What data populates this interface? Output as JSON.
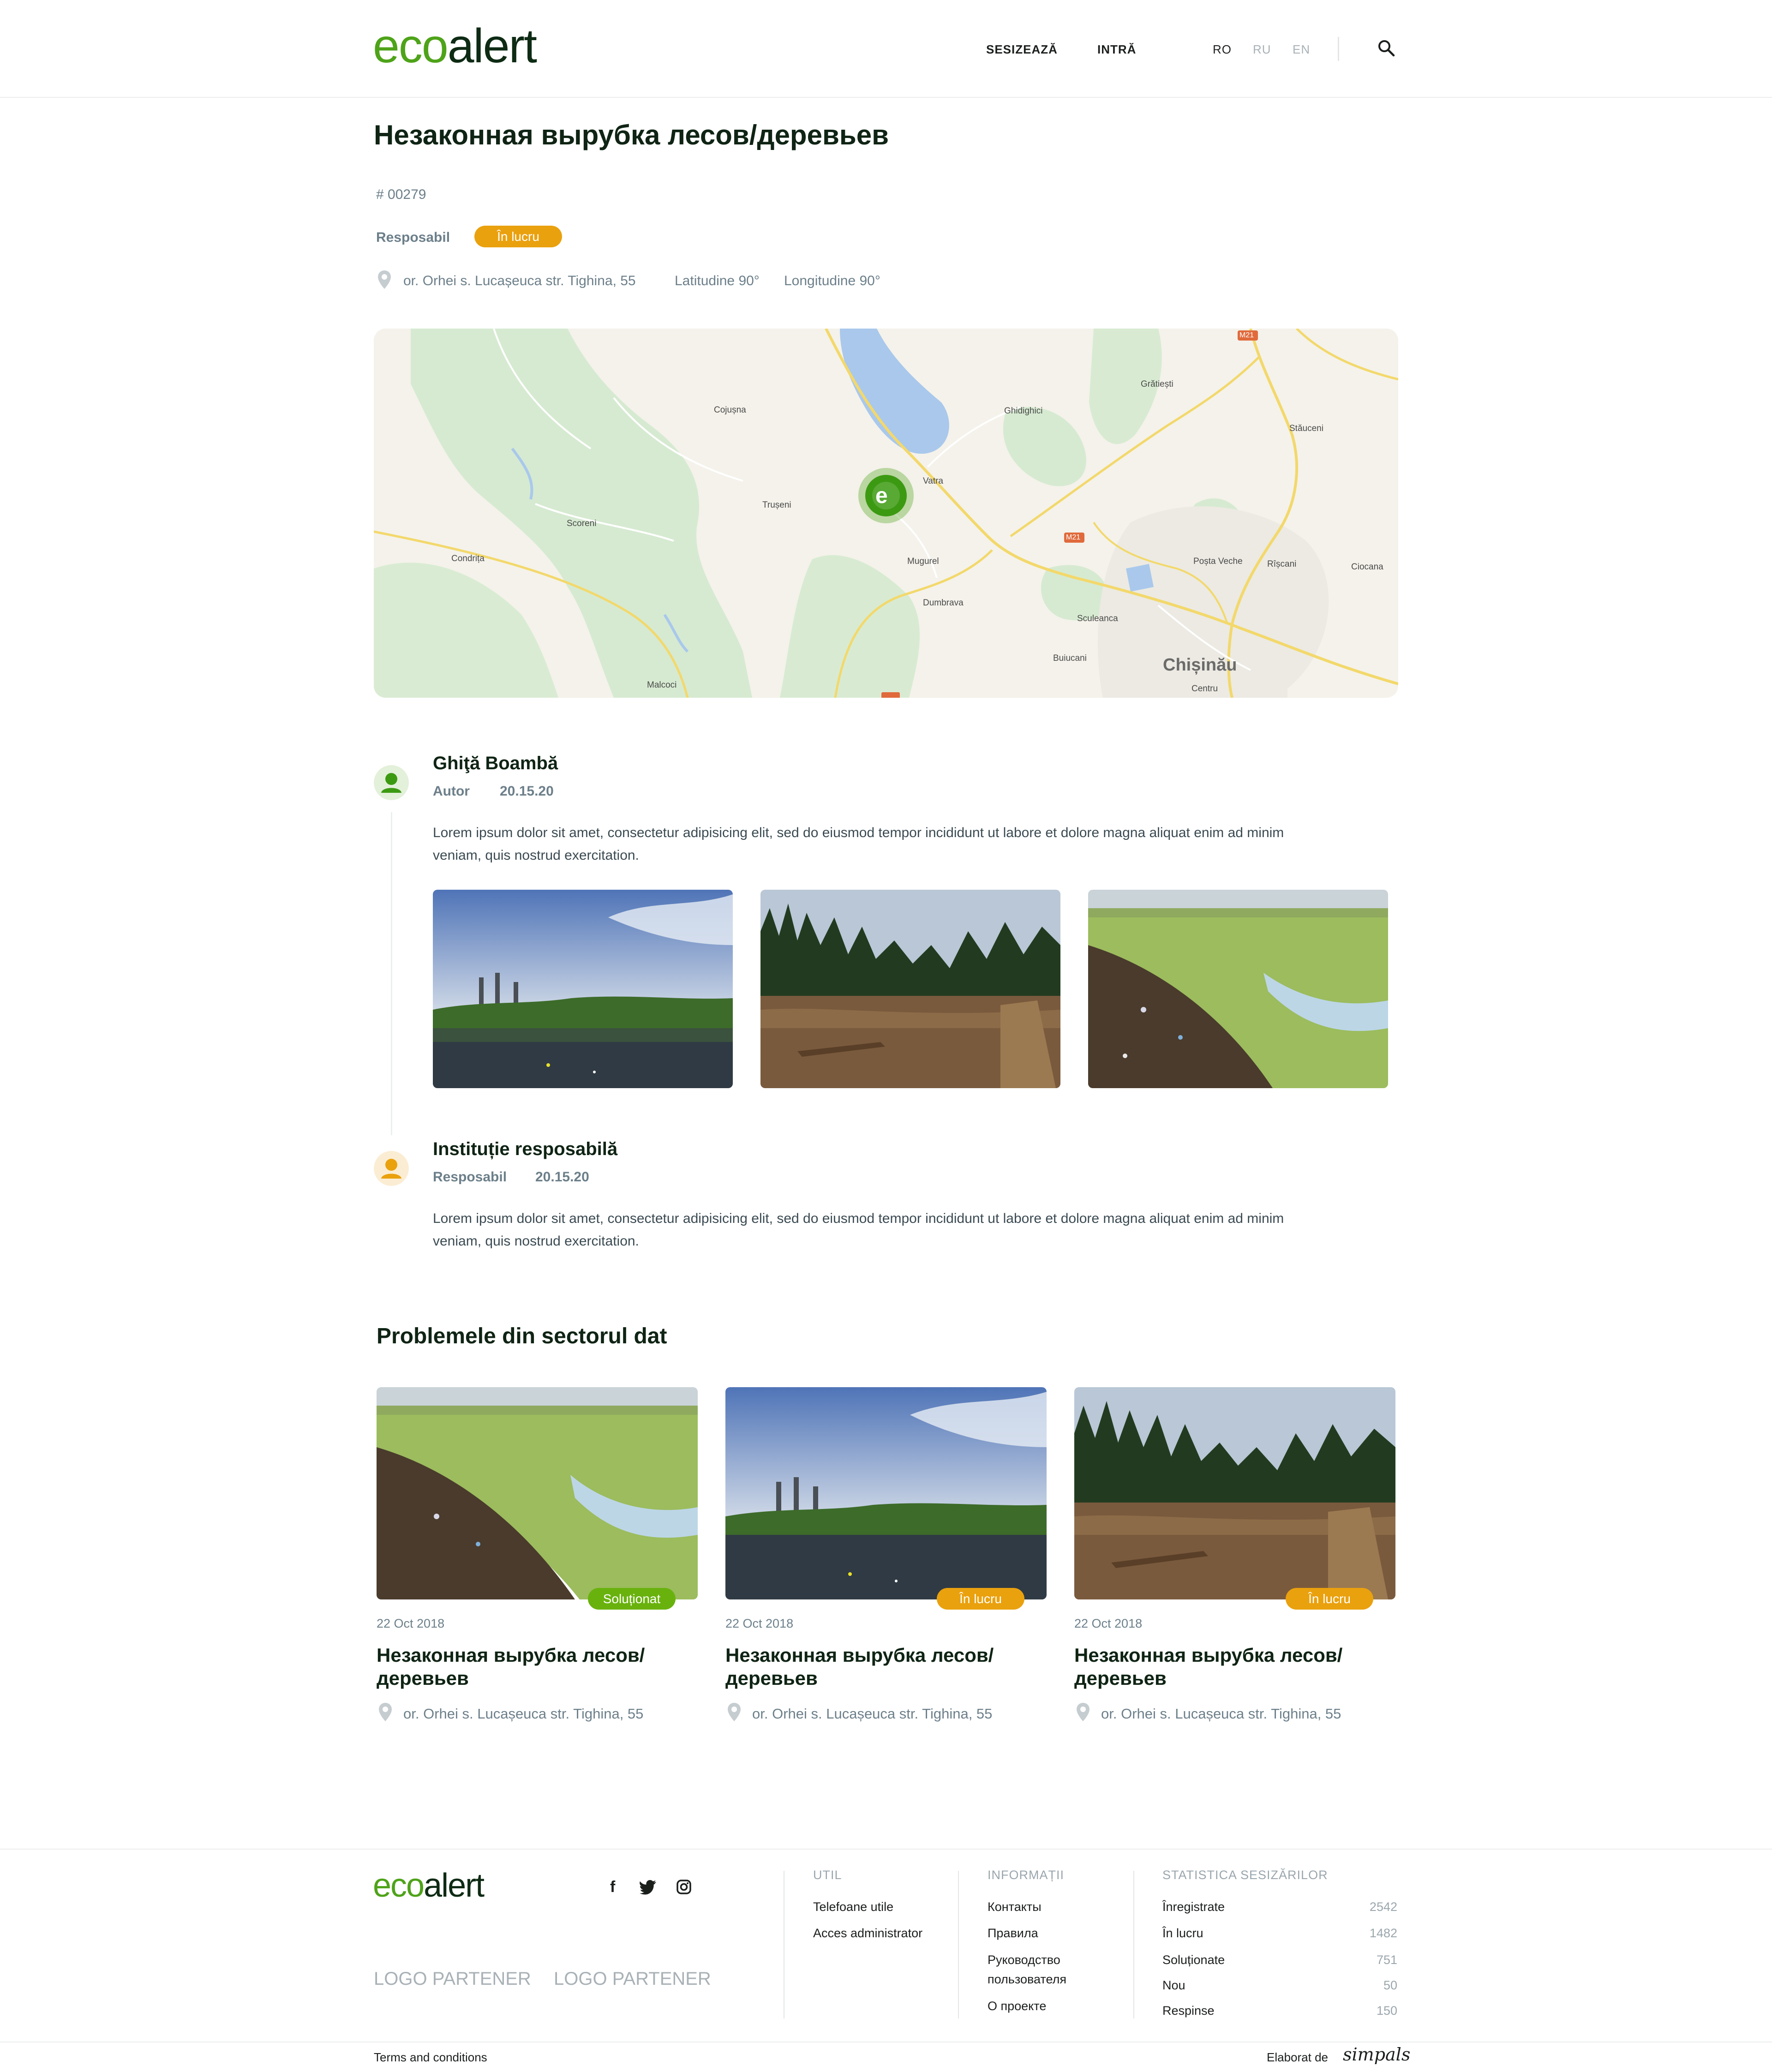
{
  "header": {
    "logo_eco": "eco",
    "logo_alert": "alert",
    "nav": [
      "SESIZEAZĂ",
      "INTRĂ"
    ],
    "languages": [
      "RO",
      "RU",
      "EN"
    ],
    "active_language": "RO",
    "search_icon": "search-icon"
  },
  "problem": {
    "title": "Незаконная вырубка лесов/деревьев",
    "id": "# 00279",
    "responsible_label": "Resposabil",
    "status": "În lucru",
    "address": "or. Orhei s. Lucașeuca str. Tighina, 55",
    "latitude": "Latitudine 90°",
    "longitude": "Longitudine 90°"
  },
  "map": {
    "labels": [
      "Cojușna",
      "Ghidighici",
      "Grătiești",
      "Stăuceni",
      "Vatra",
      "Trușeni",
      "Scoreni",
      "Condrița",
      "Mugurel",
      "Dumbrava",
      "Poșta Veche",
      "Rîșcani",
      "Ciocana",
      "Sculeanca",
      "Buiucani",
      "Chișinău",
      "Centru",
      "Malcoci"
    ],
    "road_labels": [
      "M21",
      "M21"
    ]
  },
  "timeline": [
    {
      "name": "Ghiţă Boambă",
      "role": "Autor",
      "date": "20.15.20",
      "text_line1": "Lorem ipsum dolor sit amet, consectetur adipisicing elit, sed do eiusmod tempor incididunt ut labore et dolore magna aliquat enim ad minim",
      "text_line2": "veniam, quis nostrud exercitation."
    },
    {
      "name": "Instituție resposabilă",
      "role": "Resposabil",
      "date": "20.15.20",
      "text_line1": "Lorem ipsum dolor sit amet, consectetur adipisicing elit, sed do eiusmod tempor incididunt ut labore et dolore magna aliquat enim ad minim",
      "text_line2": "veniam, quis nostrud exercitation."
    }
  ],
  "related": {
    "heading": "Problemele din sectorul dat",
    "cards": [
      {
        "status": "Soluționat",
        "date": "22 Oct 2018",
        "title_line1": "Незаконная вырубка лесов/",
        "title_line2": "деревьев",
        "address": "or. Orhei s. Lucașeuca str. Tighina, 55"
      },
      {
        "status": "În lucru",
        "date": "22 Oct 2018",
        "title_line1": "Незаконная вырубка лесов/",
        "title_line2": "деревьев",
        "address": "or. Orhei s. Lucașeuca str. Tighina, 55"
      },
      {
        "status": "În lucru",
        "date": "22 Oct 2018",
        "title_line1": "Незаконная вырубка лесов/",
        "title_line2": "деревьев",
        "address": "or. Orhei s. Lucașeuca str. Tighina, 55"
      }
    ]
  },
  "footer": {
    "logo_eco": "eco",
    "logo_alert": "alert",
    "partners": [
      "LOGO PARTENER",
      "LOGO PARTENER"
    ],
    "util": {
      "heading": "UTIL",
      "links": [
        "Telefoane utile",
        "Acces administrator"
      ]
    },
    "info": {
      "heading": "INFORMAȚII",
      "links": [
        "Контакты",
        "Правила",
        "Руководство",
        "пользователя",
        "О проекте"
      ]
    },
    "stats": {
      "heading": "STATISTICA SESIZĂRILOR",
      "rows": [
        {
          "label": "Înregistrate",
          "value": "2542"
        },
        {
          "label": "În lucru",
          "value": "1482"
        },
        {
          "label": "Soluționate",
          "value": "751"
        },
        {
          "label": "Nou",
          "value": "50"
        },
        {
          "label": "Respinse",
          "value": "150"
        }
      ]
    },
    "terms": "Terms and conditions",
    "made_by": "Elaborat de",
    "studio": "simpals"
  },
  "colors": {
    "brand_green": "#4ea319",
    "status_work": "#eaa10e",
    "status_done": "#69b20e"
  }
}
